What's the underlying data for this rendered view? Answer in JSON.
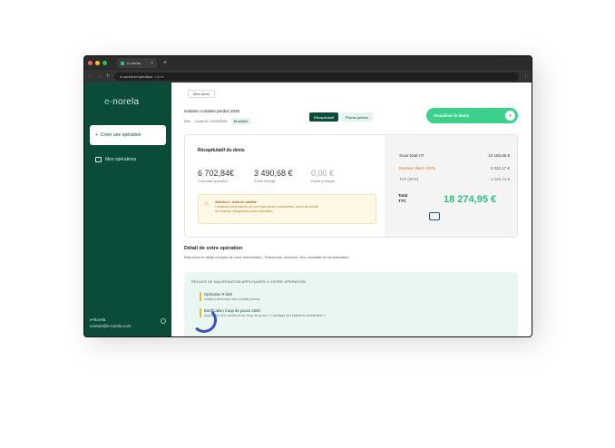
{
  "browser": {
    "tab_title": "e-norela",
    "url_host": "e-norela.fr/operation",
    "url_path": "/devis"
  },
  "sidebar": {
    "logo_prefix": "e-",
    "logo_main": "norela",
    "new_operation": "Créer une opération",
    "my_operations": "Mes opérations",
    "user_name": "e-Norela",
    "user_email": "contact@e-norela.com"
  },
  "header": {
    "breadcrumb": "Mes devis",
    "operation_title": "Isolation combles perdus 2025",
    "operation_ref": "Réf.",
    "operation_date": "Créée le 12/05/2025",
    "operation_status": "Brouillon",
    "tab_active": "Récapitulatif",
    "tab_other": "Pièces jointes",
    "validate_button": "Visualiser le devis"
  },
  "summary": {
    "title": "Récapitulatif du devis",
    "amount_1": "6 702,84€",
    "amount_1_label": "Coût total opération",
    "amount_2": "3 490,68 €",
    "amount_2_label": "Prime énergie",
    "amount_3": "0,00 €",
    "amount_3_label": "Reste à charge",
    "warning_title": "Attention : délai de validité",
    "warning_text_1": "Certaines informations ne sont pas encore complétées, merci de vérifier",
    "warning_text_2": "les champs obligatoires avant validation.",
    "subtotal_label": "Sous-total HT",
    "subtotal_value": "10 160,86 €",
    "discount_label": "Remise client +20%",
    "discount_value": "2 032,17 €",
    "tax_label": "TVA (20%)",
    "tax_value": "1 625,74 €",
    "total_label_1": "Total",
    "total_label_2": "TTC",
    "total_value": "18 274,95 €"
  },
  "detail": {
    "title": "Détail de votre opération",
    "subtitle": "Retrouvez le détail complet de votre intervention : Personnes, secteurs, lieu, modalité de rémunération.",
    "rules_header": "RÈGLES DE VALORISATION APPLIQUÉES À VOTRE OPÉRATION",
    "rule_1_title": "Opération R-020",
    "rule_1_sub": "Isolation thermique des combles perdus",
    "rule_2_title": "Bonification Coup de pouce 2025",
    "rule_2_sub": "Application des conditions du coup de pouce « Chauffage des bâtiments résidentiels »"
  },
  "colors": {
    "brand_dark": "#0b4b3a",
    "accent_green": "#3ad28b",
    "warning": "#dd6b20",
    "loader": "#3a4fbf"
  }
}
